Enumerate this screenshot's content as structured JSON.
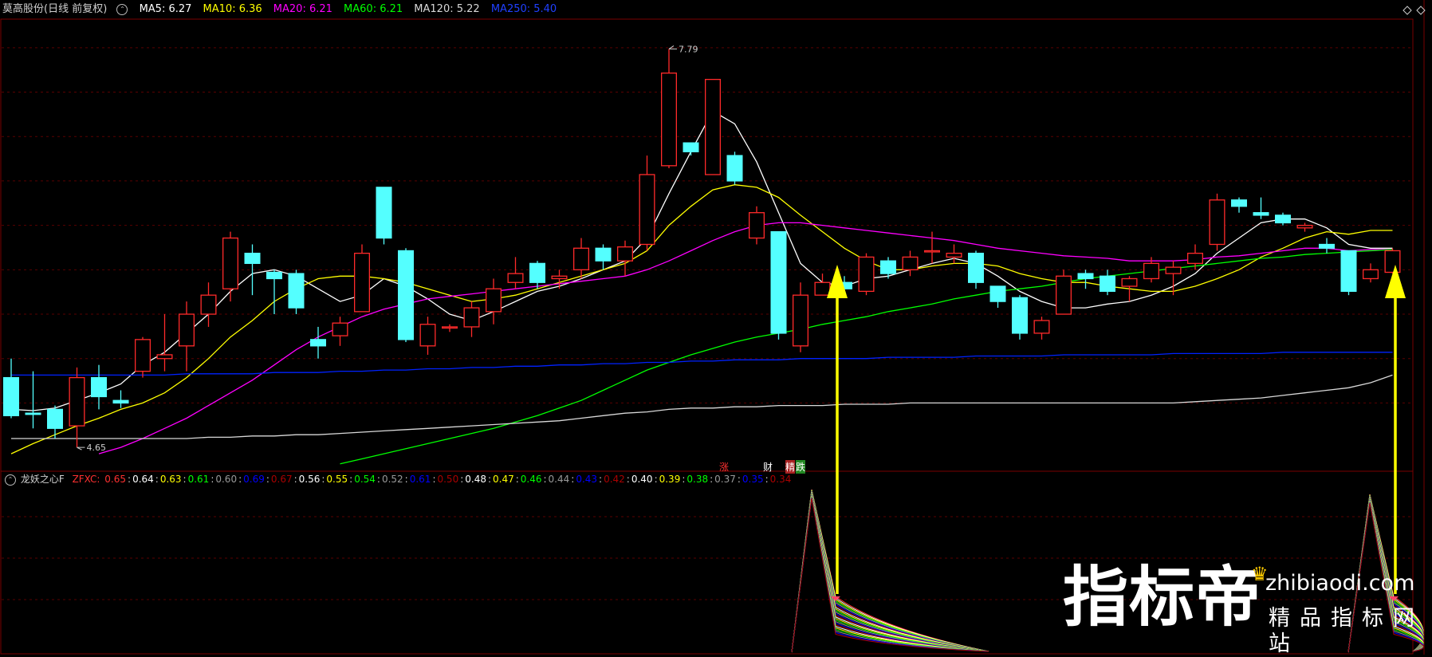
{
  "header": {
    "stock": "莫高股份(日线 前复权)",
    "ma": [
      {
        "label": "MA5: 6.27",
        "color": "#ffffff"
      },
      {
        "label": "MA10: 6.36",
        "color": "#ffff00"
      },
      {
        "label": "MA20: 6.21",
        "color": "#ff00ff"
      },
      {
        "label": "MA60: 6.21",
        "color": "#00ff00"
      },
      {
        "label": "MA120: 5.22",
        "color": "#d8d8d8"
      },
      {
        "label": "MA250: 5.40",
        "color": "#0000ff"
      }
    ]
  },
  "chart_data": {
    "type": "candlestick",
    "price_range": [
      4.5,
      8.0
    ],
    "high_label": "7.79",
    "low_label": "4.65",
    "candles": [
      [
        5.2,
        4.9,
        5.35,
        4.88
      ],
      [
        4.92,
        4.91,
        5.25,
        4.8
      ],
      [
        4.95,
        4.8,
        4.98,
        4.72
      ],
      [
        4.82,
        5.2,
        5.28,
        4.65
      ],
      [
        5.2,
        5.05,
        5.3,
        4.95
      ],
      [
        5.02,
        5.0,
        5.1,
        4.96
      ],
      [
        5.25,
        5.5,
        5.52,
        5.2
      ],
      [
        5.35,
        5.38,
        5.7,
        5.25
      ],
      [
        5.45,
        5.7,
        5.8,
        5.25
      ],
      [
        5.7,
        5.85,
        5.95,
        5.6
      ],
      [
        5.9,
        6.3,
        6.35,
        5.8
      ],
      [
        6.18,
        6.1,
        6.25,
        5.85
      ],
      [
        6.03,
        5.98,
        6.05,
        5.7
      ],
      [
        6.02,
        5.75,
        6.05,
        5.7
      ],
      [
        5.5,
        5.45,
        5.6,
        5.35
      ],
      [
        5.53,
        5.63,
        5.68,
        5.45
      ],
      [
        5.72,
        6.18,
        6.25,
        5.72
      ],
      [
        6.7,
        6.3,
        6.7,
        6.25
      ],
      [
        6.2,
        5.5,
        6.22,
        5.48
      ],
      [
        5.45,
        5.62,
        5.68,
        5.38
      ],
      [
        5.6,
        5.6,
        5.62,
        5.56
      ],
      [
        5.6,
        5.75,
        5.8,
        5.52
      ],
      [
        5.72,
        5.9,
        5.98,
        5.62
      ],
      [
        5.95,
        6.02,
        6.15,
        5.9
      ],
      [
        6.1,
        5.95,
        6.12,
        5.9
      ],
      [
        5.98,
        6.0,
        6.05,
        5.9
      ],
      [
        6.05,
        6.22,
        6.3,
        5.98
      ],
      [
        6.22,
        6.12,
        6.25,
        6.05
      ],
      [
        6.12,
        6.23,
        6.28,
        6.0
      ],
      [
        6.25,
        6.8,
        6.95,
        6.2
      ],
      [
        6.87,
        7.6,
        7.79,
        6.85
      ],
      [
        7.05,
        6.98,
        7.05,
        6.95
      ],
      [
        6.8,
        7.55,
        7.55,
        6.8
      ],
      [
        6.95,
        6.75,
        6.98,
        6.72
      ],
      [
        6.3,
        6.5,
        6.55,
        6.25
      ],
      [
        6.35,
        5.55,
        6.35,
        5.5
      ],
      [
        5.45,
        5.85,
        5.95,
        5.4
      ],
      [
        5.85,
        5.95,
        6.02,
        5.85
      ],
      [
        5.95,
        5.9,
        6.0,
        5.85
      ],
      [
        5.88,
        6.15,
        6.18,
        5.85
      ],
      [
        6.12,
        6.02,
        6.15,
        5.98
      ],
      [
        6.05,
        6.15,
        6.2,
        6.0
      ],
      [
        6.2,
        6.2,
        6.35,
        6.1
      ],
      [
        6.15,
        6.18,
        6.25,
        6.1
      ],
      [
        6.18,
        5.95,
        6.2,
        5.9
      ],
      [
        5.92,
        5.8,
        5.92,
        5.75
      ],
      [
        5.83,
        5.55,
        5.85,
        5.5
      ],
      [
        5.55,
        5.65,
        5.68,
        5.5
      ],
      [
        5.7,
        6.0,
        6.05,
        5.7
      ],
      [
        6.02,
        5.98,
        6.05,
        5.9
      ],
      [
        6.0,
        5.88,
        6.05,
        5.85
      ],
      [
        5.92,
        5.98,
        6.0,
        5.8
      ],
      [
        5.98,
        6.1,
        6.15,
        5.95
      ],
      [
        6.02,
        6.07,
        6.12,
        5.85
      ],
      [
        6.1,
        6.18,
        6.25,
        6.05
      ],
      [
        6.25,
        6.6,
        6.65,
        6.2
      ],
      [
        6.6,
        6.55,
        6.62,
        6.5
      ],
      [
        6.5,
        6.48,
        6.62,
        6.45
      ],
      [
        6.48,
        6.42,
        6.5,
        6.4
      ],
      [
        6.38,
        6.4,
        6.42,
        6.35
      ],
      [
        6.25,
        6.22,
        6.3,
        6.18
      ],
      [
        6.2,
        5.88,
        6.2,
        5.85
      ],
      [
        5.98,
        6.05,
        6.1,
        5.95
      ],
      [
        6.03,
        6.2,
        6.22,
        6.02
      ]
    ],
    "ma_series": [
      {
        "name": "MA5",
        "color": "#ffffff",
        "values": [
          4.95,
          4.94,
          4.96,
          5.02,
          5.08,
          5.15,
          5.3,
          5.4,
          5.55,
          5.7,
          5.88,
          6.02,
          6.05,
          6.0,
          5.9,
          5.8,
          5.85,
          5.98,
          5.92,
          5.82,
          5.7,
          5.65,
          5.72,
          5.8,
          5.88,
          5.92,
          5.98,
          6.05,
          6.12,
          6.3,
          6.65,
          6.98,
          7.3,
          7.2,
          6.9,
          6.5,
          6.1,
          5.95,
          5.92,
          5.98,
          6.0,
          6.05,
          6.1,
          6.14,
          6.1,
          6.0,
          5.88,
          5.8,
          5.75,
          5.75,
          5.78,
          5.8,
          5.85,
          5.92,
          6.02,
          6.18,
          6.3,
          6.42,
          6.45,
          6.45,
          6.38,
          6.25,
          6.22,
          6.22
        ]
      },
      {
        "name": "MA10",
        "color": "#ffff00",
        "values": [
          4.6,
          4.68,
          4.75,
          4.82,
          4.88,
          4.95,
          5.0,
          5.08,
          5.2,
          5.35,
          5.52,
          5.65,
          5.8,
          5.9,
          5.98,
          6.0,
          6.0,
          5.98,
          5.95,
          5.9,
          5.85,
          5.8,
          5.82,
          5.85,
          5.9,
          5.95,
          6.0,
          6.05,
          6.1,
          6.2,
          6.4,
          6.55,
          6.68,
          6.72,
          6.7,
          6.62,
          6.48,
          6.35,
          6.22,
          6.12,
          6.05,
          6.05,
          6.08,
          6.1,
          6.1,
          6.08,
          6.02,
          5.98,
          5.95,
          5.95,
          5.92,
          5.9,
          5.88,
          5.88,
          5.92,
          5.98,
          6.05,
          6.15,
          6.22,
          6.3,
          6.35,
          6.33,
          6.36,
          6.36
        ]
      },
      {
        "name": "MA20",
        "color": "#ff00ff",
        "values": [
          null,
          null,
          null,
          null,
          4.6,
          4.65,
          4.72,
          4.8,
          4.88,
          4.98,
          5.08,
          5.18,
          5.3,
          5.42,
          5.52,
          5.6,
          5.68,
          5.74,
          5.78,
          5.82,
          5.84,
          5.86,
          5.88,
          5.9,
          5.92,
          5.94,
          5.96,
          5.98,
          6.0,
          6.05,
          6.12,
          6.2,
          6.28,
          6.35,
          6.4,
          6.42,
          6.42,
          6.4,
          6.38,
          6.36,
          6.34,
          6.32,
          6.3,
          6.28,
          6.25,
          6.22,
          6.2,
          6.18,
          6.16,
          6.15,
          6.14,
          6.12,
          6.12,
          6.12,
          6.13,
          6.15,
          6.16,
          6.18,
          6.2,
          6.22,
          6.22,
          6.2,
          6.21,
          6.21
        ]
      },
      {
        "name": "MA60",
        "color": "#00ff00",
        "values": [
          null,
          null,
          null,
          null,
          null,
          null,
          null,
          null,
          null,
          null,
          null,
          null,
          null,
          null,
          null,
          4.52,
          4.56,
          4.6,
          4.64,
          4.68,
          4.72,
          4.76,
          4.8,
          4.85,
          4.9,
          4.96,
          5.02,
          5.1,
          5.18,
          5.26,
          5.32,
          5.38,
          5.43,
          5.48,
          5.52,
          5.55,
          5.58,
          5.62,
          5.65,
          5.68,
          5.72,
          5.75,
          5.78,
          5.82,
          5.85,
          5.88,
          5.9,
          5.92,
          5.95,
          5.98,
          6.0,
          6.02,
          6.04,
          6.06,
          6.08,
          6.1,
          6.12,
          6.14,
          6.15,
          6.17,
          6.18,
          6.19,
          6.2,
          6.21
        ]
      },
      {
        "name": "MA120",
        "color": "#d8d8d8",
        "values": [
          4.72,
          4.72,
          4.72,
          4.72,
          4.72,
          4.72,
          4.72,
          4.72,
          4.72,
          4.73,
          4.73,
          4.74,
          4.74,
          4.75,
          4.75,
          4.76,
          4.77,
          4.78,
          4.79,
          4.8,
          4.81,
          4.82,
          4.83,
          4.84,
          4.85,
          4.86,
          4.88,
          4.9,
          4.92,
          4.93,
          4.95,
          4.96,
          4.96,
          4.97,
          4.97,
          4.98,
          4.98,
          4.98,
          4.99,
          4.99,
          4.99,
          5.0,
          5.0,
          5.0,
          5.0,
          5.0,
          5.0,
          5.0,
          5.0,
          5.0,
          5.0,
          5.0,
          5.0,
          5.0,
          5.01,
          5.02,
          5.03,
          5.04,
          5.06,
          5.08,
          5.1,
          5.12,
          5.16,
          5.22
        ]
      },
      {
        "name": "MA250",
        "color": "#0022ff",
        "values": [
          5.22,
          5.22,
          5.22,
          5.22,
          5.22,
          5.22,
          5.22,
          5.22,
          5.23,
          5.23,
          5.23,
          5.23,
          5.24,
          5.24,
          5.24,
          5.25,
          5.25,
          5.26,
          5.26,
          5.27,
          5.27,
          5.28,
          5.28,
          5.29,
          5.29,
          5.3,
          5.3,
          5.31,
          5.31,
          5.32,
          5.32,
          5.33,
          5.33,
          5.34,
          5.34,
          5.34,
          5.35,
          5.35,
          5.35,
          5.35,
          5.36,
          5.36,
          5.36,
          5.36,
          5.37,
          5.37,
          5.37,
          5.37,
          5.38,
          5.38,
          5.38,
          5.38,
          5.38,
          5.39,
          5.39,
          5.39,
          5.39,
          5.39,
          5.4,
          5.4,
          5.4,
          5.4,
          5.4,
          5.4
        ]
      }
    ]
  },
  "markers": {
    "zhang": "涨",
    "cai": "财",
    "jing": "精",
    "die": "跌"
  },
  "indicator": {
    "name": "龙妖之心F",
    "label": "ZFXC:",
    "values": [
      {
        "text": "0.65",
        "color": "#ff3030"
      },
      {
        "text": "0.64",
        "color": "#ffffff"
      },
      {
        "text": "0.63",
        "color": "#ffff00"
      },
      {
        "text": "0.61",
        "color": "#00ff00"
      },
      {
        "text": "0.60",
        "color": "#999999"
      },
      {
        "text": "0.69",
        "color": "#0000ff"
      },
      {
        "text": "0.67",
        "color": "#aa0000"
      },
      {
        "text": "0.56",
        "color": "#ffffff"
      },
      {
        "text": "0.55",
        "color": "#ffff00"
      },
      {
        "text": "0.54",
        "color": "#00ff00"
      },
      {
        "text": "0.52",
        "color": "#999999"
      },
      {
        "text": "0.61",
        "color": "#0000ff"
      },
      {
        "text": "0.50",
        "color": "#aa0000"
      },
      {
        "text": "0.48",
        "color": "#ffffff"
      },
      {
        "text": "0.47",
        "color": "#ffff00"
      },
      {
        "text": "0.46",
        "color": "#00ff00"
      },
      {
        "text": "0.44",
        "color": "#999999"
      },
      {
        "text": "0.43",
        "color": "#0000ff"
      },
      {
        "text": "0.42",
        "color": "#aa0000"
      },
      {
        "text": "0.40",
        "color": "#ffffff"
      },
      {
        "text": "0.39",
        "color": "#ffff00"
      },
      {
        "text": "0.38",
        "color": "#00ff00"
      },
      {
        "text": "0.37",
        "color": "#999999"
      },
      {
        "text": "0.35",
        "color": "#0000ff"
      },
      {
        "text": "0.34",
        "color": "#aa0000"
      }
    ]
  },
  "watermark": {
    "logo": "指标帝",
    "domain": "zhibiaodi.com",
    "slogan": "精品指标网站"
  },
  "colors": {
    "up": "#ff2a2a",
    "down": "#54ffff",
    "grid": "#5a0000",
    "arrow": "#ffff00"
  }
}
